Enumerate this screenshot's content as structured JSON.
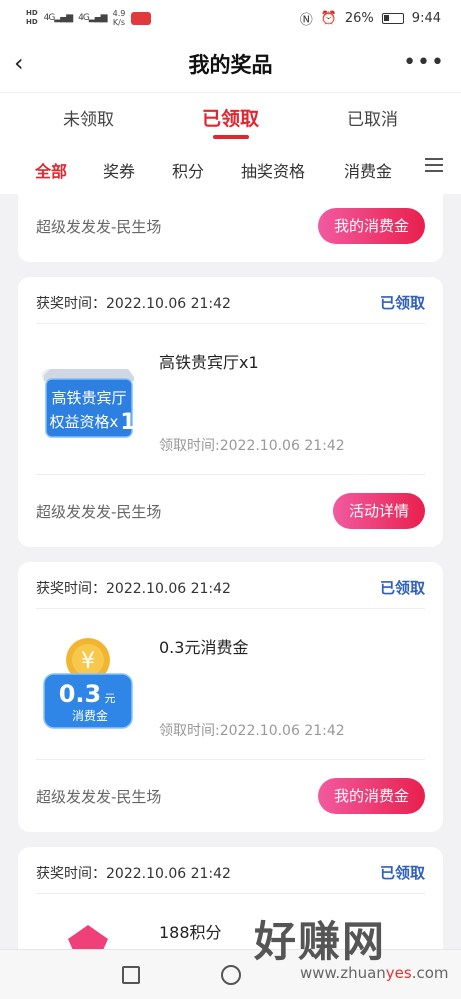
{
  "status_bar": {
    "hd1": "HD",
    "hd2": "HD",
    "sig1": "4G",
    "sig2": "4G",
    "speed_value": "4.9",
    "speed_unit": "K/s",
    "battery_pct": "26%",
    "time": "9:44"
  },
  "header": {
    "title": "我的奖品"
  },
  "tabs": [
    {
      "label": "未领取"
    },
    {
      "label": "已领取"
    },
    {
      "label": "已取消"
    }
  ],
  "categories": [
    {
      "label": "全部"
    },
    {
      "label": "奖券"
    },
    {
      "label": "积分"
    },
    {
      "label": "抽奖资格"
    },
    {
      "label": "消费金"
    }
  ],
  "cards": [
    {
      "source": "超级发发发-民生场",
      "action": "我的消费金"
    },
    {
      "win_time": "获奖时间：2022.10.06 21:42",
      "status": "已领取",
      "prize_name": "高铁贵宾厅x1",
      "thumb_line1": "高铁贵宾厅",
      "thumb_line2": "权益资格x",
      "thumb_num": "1",
      "claim_time": "领取时间:2022.10.06 21:42",
      "source": "超级发发发-民生场",
      "action": "活动详情"
    },
    {
      "win_time": "获奖时间：2022.10.06 21:42",
      "status": "已领取",
      "prize_name": "0.3元消费金",
      "thumb_amount": "0.3",
      "thumb_unit": "元",
      "thumb_label": "消费金",
      "claim_time": "领取时间:2022.10.06 21:42",
      "source": "超级发发发-民生场",
      "action": "我的消费金"
    },
    {
      "win_time": "获奖时间：2022.10.06 21:42",
      "status": "已领取",
      "prize_name": "188积分"
    }
  ],
  "watermark": {
    "big": "好赚网",
    "url_pre": "www.zhuan",
    "url_hl": "yes",
    "url_post": ".com"
  },
  "colors": {
    "accent": "#e4252f",
    "status_blue": "#2f5fbf",
    "pill_start": "#f25aa0",
    "pill_end": "#e8204d"
  }
}
